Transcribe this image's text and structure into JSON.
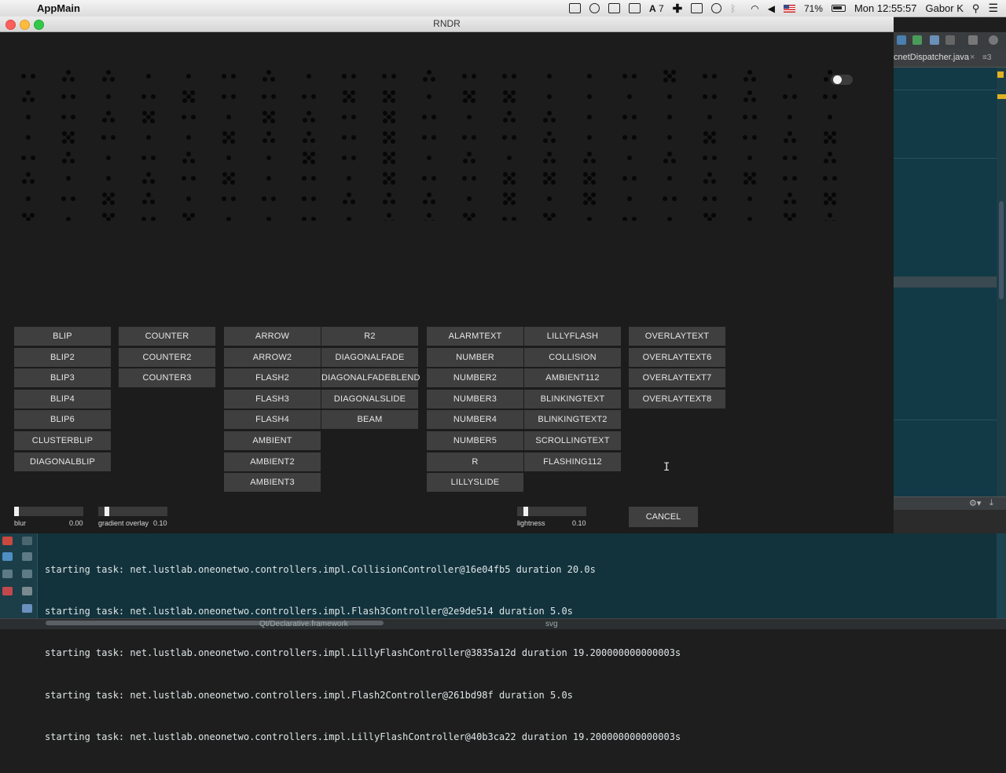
{
  "menubar": {
    "app_name": "AppMain",
    "badge_count": "7",
    "battery_percent": "71%",
    "clock": "Mon 12:55:57",
    "user": "Gabor K"
  },
  "window": {
    "title": "RNDR"
  },
  "columns": [
    [
      "BLIP",
      "BLIP2",
      "BLIP3",
      "BLIP4",
      "BLIP6",
      "CLUSTERBLIP",
      "DIAGONALBLIP"
    ],
    [
      "COUNTER",
      "COUNTER2",
      "COUNTER3"
    ],
    [
      "ARROW",
      "ARROW2",
      "FLASH2",
      "FLASH3",
      "FLASH4",
      "AMBIENT",
      "AMBIENT2",
      "AMBIENT3"
    ],
    [
      "R2",
      "DIAGONALFADE",
      "DIAGONALFADEBLEND",
      "DIAGONALSLIDE",
      "BEAM"
    ],
    [
      "ALARMTEXT",
      "NUMBER",
      "NUMBER2",
      "NUMBER3",
      "NUMBER4",
      "NUMBER5",
      "R",
      "LILLYSLIDE"
    ],
    [
      "LILLYFLASH",
      "COLLISION",
      "AMBIENT112",
      "BLINKINGTEXT",
      "BLINKINGTEXT2",
      "SCROLLINGTEXT",
      "FLASHING112"
    ],
    [
      "OVERLAYTEXT",
      "OVERLAYTEXT6",
      "OVERLAYTEXT7",
      "OVERLAYTEXT8"
    ]
  ],
  "sliders": {
    "blur": {
      "label": "blur",
      "value": "0.00",
      "level": 0.0
    },
    "gradient_overlay": {
      "label": "gradient overlay",
      "value": "0.10",
      "level": 0.1
    },
    "lightness": {
      "label": "lightness",
      "value": "0.10",
      "level": 0.1
    }
  },
  "cancel_label": "CANCEL",
  "ide": {
    "tab_label": "cnetDispatcher.java",
    "close_glyph": "×",
    "tab_menu": "≡3"
  },
  "console": {
    "lines": [
      "starting task: net.lustlab.oneonetwo.controllers.impl.CollisionController@16e04fb5 duration 20.0s",
      "starting task: net.lustlab.oneonetwo.controllers.impl.Flash3Controller@2e9de514 duration 5.0s",
      "starting task: net.lustlab.oneonetwo.controllers.impl.LillyFlashController@3835a12d duration 19.200000000000003s",
      "starting task: net.lustlab.oneonetwo.controllers.impl.Flash2Controller@261bd98f duration 5.0s",
      "starting task: net.lustlab.oneonetwo.controllers.impl.LillyFlashController@40b3ca22 duration 19.200000000000003s"
    ]
  },
  "bottombar": {
    "left_text": "Qt/Declarative.framework",
    "right_text": "svg"
  },
  "colors": {
    "window_bg": "#1c1c1c",
    "button_bg": "#3f3f3f",
    "console_bg": "#12323c",
    "accent_marker": "#e0b220"
  }
}
